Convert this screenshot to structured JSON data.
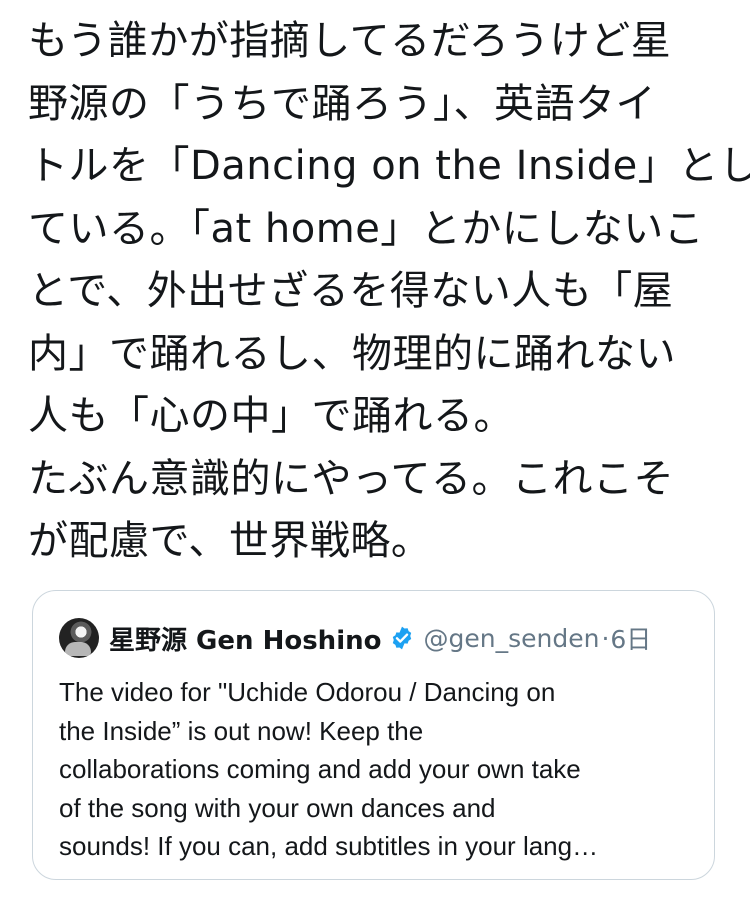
{
  "tweet": {
    "lines": [
      "もう誰かが指摘してるだろうけど星",
      "野源の「うちで踊ろう」、英語タイ",
      "トルを「Dancing on the Inside」とし",
      "ている。「at home」とかにしないこ",
      "とで、外出せざるを得ない人も「屋",
      "内」で踊れるし、物理的に踊れない",
      "人も「心の中」で踊れる。",
      "たぶん意識的にやってる。これこそ",
      "が配慮で、世界戦略。"
    ]
  },
  "quote": {
    "avatar_icon": "avatar-photo",
    "display_name": "星野源 Gen Hoshino",
    "verified_icon": "verified-badge-icon",
    "handle": "@gen_senden",
    "separator": "·",
    "time": "6日",
    "body_lines": [
      "The video for \"Uchide Odorou / Dancing on",
      "the Inside” is out now! Keep the",
      "collaborations coming and add your own take",
      "of the song with your own dances and",
      "sounds! If you can, add subtitles in your lang…"
    ]
  },
  "colors": {
    "text": "#14171a",
    "muted": "#657786",
    "border": "#ccd6dd",
    "verified": "#1da1f2"
  }
}
